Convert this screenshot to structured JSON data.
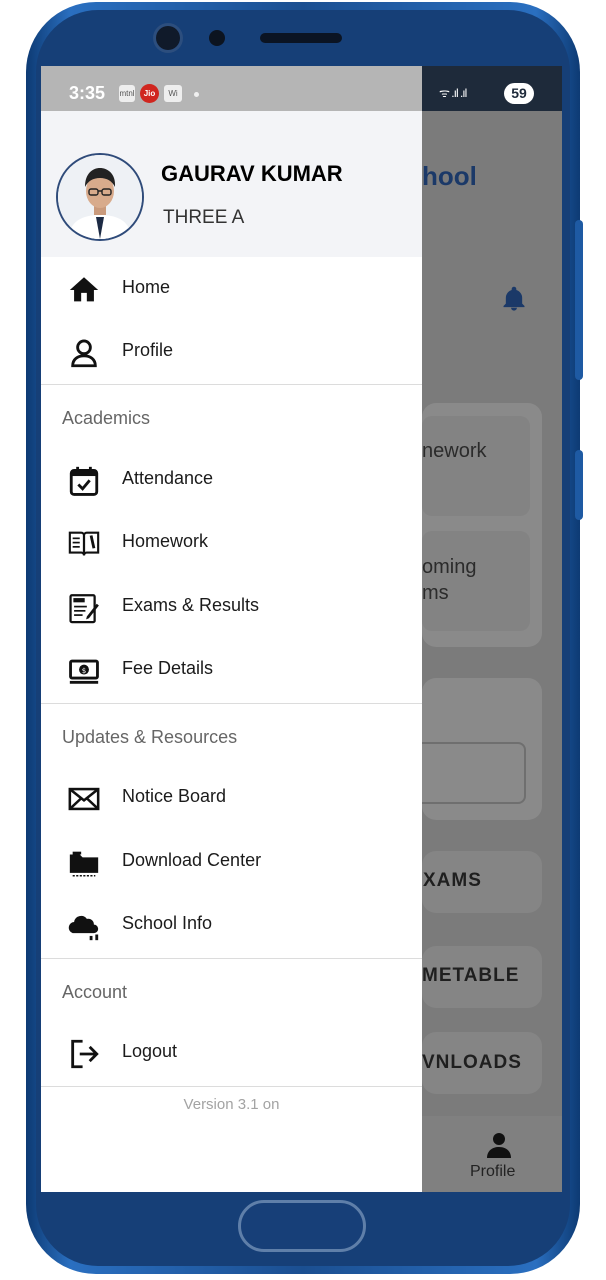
{
  "status_bar": {
    "time": "3:35",
    "carrier_chip_1": "mtnl",
    "carrier_jio": "Jio",
    "carrier_chip_2": "Wi",
    "signal": "ᯤ .ıl .ıl",
    "battery": "59"
  },
  "background_app": {
    "title_fragment": "hool",
    "card_1": "nework",
    "card_2_line1": "oming",
    "card_2_line2": "ms",
    "btn_exams": "XAMS",
    "btn_timetable": "METABLE",
    "btn_downloads": "VNLOADS",
    "bottom_profile": "Profile"
  },
  "drawer": {
    "user_name": "GAURAV KUMAR",
    "user_class": "THREE A",
    "main_items": [
      {
        "label": "Home",
        "icon": "home-icon"
      },
      {
        "label": "Profile",
        "icon": "person-icon"
      }
    ],
    "sections": [
      {
        "title": "Academics",
        "items": [
          {
            "label": "Attendance",
            "icon": "calendar-check-icon"
          },
          {
            "label": "Homework",
            "icon": "book-icon"
          },
          {
            "label": "Exams & Results",
            "icon": "exam-icon"
          },
          {
            "label": "Fee Details",
            "icon": "money-icon"
          }
        ]
      },
      {
        "title": "Updates & Resources",
        "items": [
          {
            "label": "Notice Board",
            "icon": "envelope-icon"
          },
          {
            "label": "Download Center",
            "icon": "folder-icon"
          },
          {
            "label": "School Info",
            "icon": "cloud-info-icon"
          }
        ]
      },
      {
        "title": "Account",
        "items": [
          {
            "label": "Logout",
            "icon": "logout-icon"
          }
        ]
      }
    ],
    "version": "Version 3.1 on"
  },
  "colors": {
    "phone_blue": "#1b4f91",
    "title_blue": "#1b3968",
    "header_bg": "#f3f4f7"
  }
}
